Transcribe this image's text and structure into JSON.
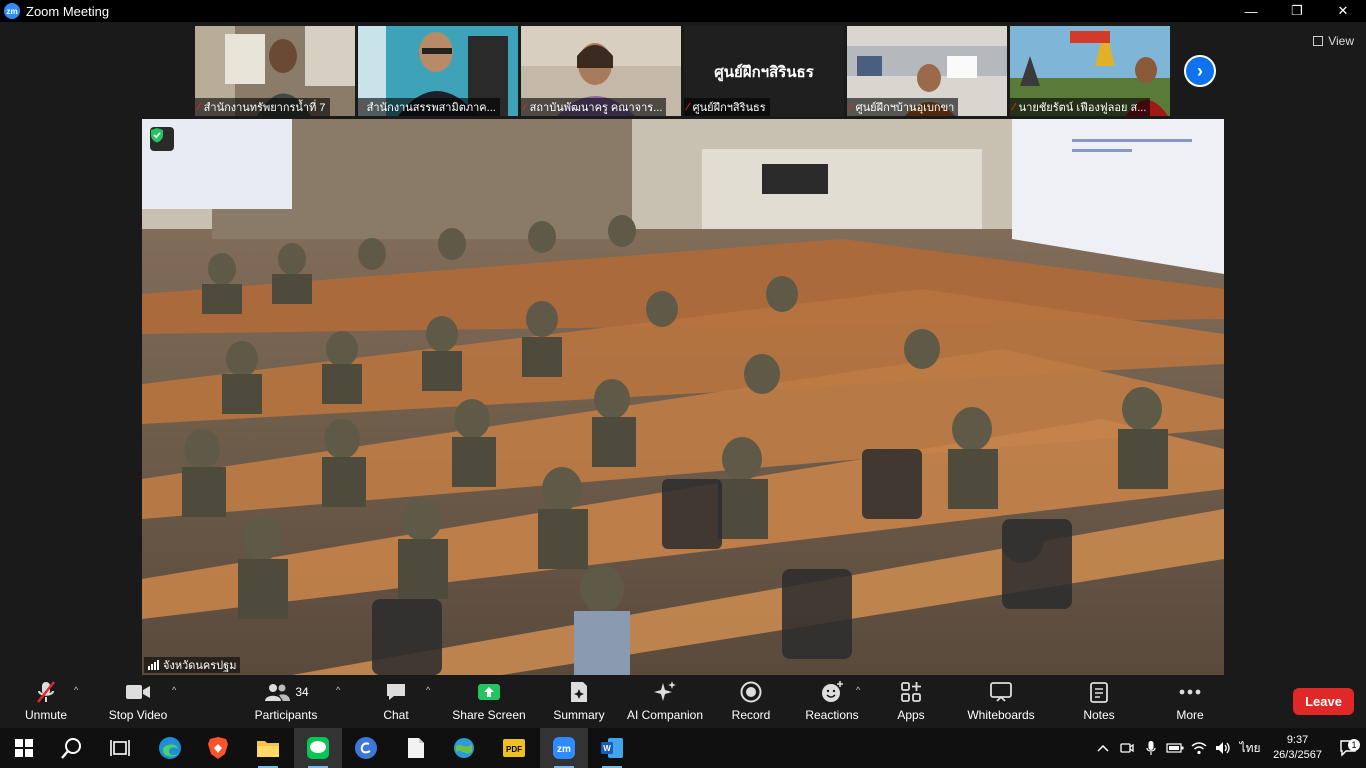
{
  "window": {
    "title": "Zoom Meeting",
    "logo_text": "zm",
    "minimize_label": "—",
    "restore_label": "❐",
    "close_label": "✕"
  },
  "gallery": {
    "tiles": [
      {
        "name": "สำนักงานทรัพยากรน้ำที่ 7",
        "muted": true
      },
      {
        "name": "สำนักงานสรรพสามิตภาค...",
        "muted": true
      },
      {
        "name": "สถาบันพัฒนาครู คณาจาร...",
        "muted": true
      },
      {
        "name": "ศูนย์ฝึกฯสิรินธร",
        "muted": true,
        "big_name": "ศูนย์ฝึกฯสิรินธร"
      },
      {
        "name": "ศูนย์ฝึกฯบ้านอุเบกขา",
        "muted": true
      },
      {
        "name": "นายชัยรัตน์ เฟืองฟูลอย ส...",
        "muted": true
      }
    ],
    "next_label": "›",
    "view_label": "View"
  },
  "main_video": {
    "speaker_name": "จังหวัดนครปฐม"
  },
  "toolbar": {
    "unmute": "Unmute",
    "stop_video": "Stop Video",
    "participants": "Participants",
    "participants_count": "34",
    "chat": "Chat",
    "share_screen": "Share Screen",
    "summary": "Summary",
    "ai_companion": "AI Companion",
    "record": "Record",
    "reactions": "Reactions",
    "apps": "Apps",
    "whiteboards": "Whiteboards",
    "notes": "Notes",
    "more": "More",
    "leave": "Leave"
  },
  "taskbar": {
    "language": "ไทย",
    "time": "9:37",
    "date": "26/3/2567",
    "notification_count": "1"
  },
  "colors": {
    "zoom_blue": "#2D8CFF",
    "share_green": "#23c461",
    "leave_red": "#e02828",
    "mute_red": "#e02828"
  }
}
